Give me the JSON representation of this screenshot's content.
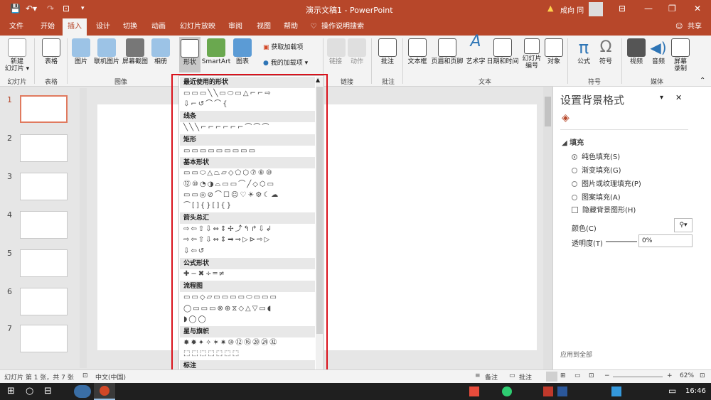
{
  "titlebar": {
    "doc_title": "演示文稿1 - PowerPoint",
    "user": "成向 同"
  },
  "tabs": [
    "文件",
    "开始",
    "插入",
    "设计",
    "切换",
    "动画",
    "幻灯片放映",
    "审阅",
    "视图",
    "帮助"
  ],
  "tell_me": "操作说明搜索",
  "share": "共享",
  "ribbon": {
    "groups": [
      "幻灯片",
      "表格",
      "图像",
      "链接",
      "批注",
      "文本",
      "符号",
      "媒体"
    ],
    "buttons": {
      "new_slide": "新建\n幻灯片 ▾",
      "table": "表格",
      "picture": "图片",
      "online_pic": "联机图片",
      "screenshot": "屏幕截图",
      "album": "相册",
      "shapes": "形状",
      "smartart": "SmartArt",
      "chart": "图表",
      "get_addins": "获取加载项",
      "my_addins": "我的加载项",
      "link": "链接",
      "action": "动作",
      "comment": "批注",
      "textbox": "文本框",
      "header_footer": "页眉和页脚",
      "wordart": "艺术字",
      "datetime": "日期和时间",
      "slide_number": "幻灯片\n编号",
      "object": "对象",
      "equation": "公式",
      "symbol": "符号",
      "video": "视频",
      "audio": "音频",
      "screen_rec": "屏幕\n录制"
    }
  },
  "slides": [
    "1",
    "2",
    "3",
    "4",
    "5",
    "6",
    "7"
  ],
  "shapes_menu": {
    "sections": [
      "最近使用的形状",
      "线条",
      "矩形",
      "基本形状",
      "箭头总汇",
      "公式形状",
      "流程图",
      "星与旗帜",
      "标注"
    ],
    "rows": {
      "recent": [
        "▭▭▭╲╲▭⬭▭△⌐⌐⇨",
        "⇩⌐↺⌒⌒{"
      ],
      "lines": [
        "╲╲╲⌐⌐⌐⌐⌐⌐⌒⌒⌒"
      ],
      "rect": [
        "▭▭▭▭▭▭▭▭▭"
      ],
      "basic": [
        "▭▭⬭△⏢▱◇⬠⬡⑦⑧⑩",
        "⑫⑩◔◑⌓▭▭⌒╱◇⬡▭",
        "▭▭◎⊘⌒☐☺♡☀⚙☾☁",
        "⌒[]{}[]{}"
      ],
      "arrows": [
        "⇨⇦⇧⇩⇔⇕✢⤴↰↱⇩↲",
        "⇨⇦⇧⇩⇔⇕➡⇒▷⊳⇨▷",
        "⇩⇦↺"
      ],
      "equation": [
        "✚−✖÷═≠"
      ],
      "flow": [
        "▭▭◇▱▭▭▭▭⬭▭▭▭",
        "◯▭▭▭⊗⊕⧖◇△▽▭◖",
        "◗◯◯"
      ],
      "stars": [
        "✸✹✦✧✶✷⑩⑫⑯⑳㉔㉜",
        "⬚⬚⬚⬚⬚⬚⬚"
      ],
      "callouts": [
        "▭▭▭▭▭▭▭▭▭▭▭▭"
      ]
    }
  },
  "panel": {
    "title": "设置背景格式",
    "section": "填充",
    "options": [
      "纯色填充(S)",
      "渐变填充(G)",
      "图片或纹理填充(P)",
      "图案填充(A)",
      "隐藏背景图形(H)"
    ],
    "color_label": "颜色(C)",
    "transparency_label": "透明度(T)",
    "transparency_value": "0%",
    "apply_all": "应用到全部"
  },
  "status": {
    "slide_info": "幻灯片 第 1 张，共 7 张",
    "lang": "中文(中国)",
    "notes": "备注",
    "comments": "批注",
    "zoom": "62%"
  },
  "taskbar": {
    "time": "16:46"
  },
  "colors": {
    "accent": "#b7472a",
    "highlight": "#d9121c"
  }
}
